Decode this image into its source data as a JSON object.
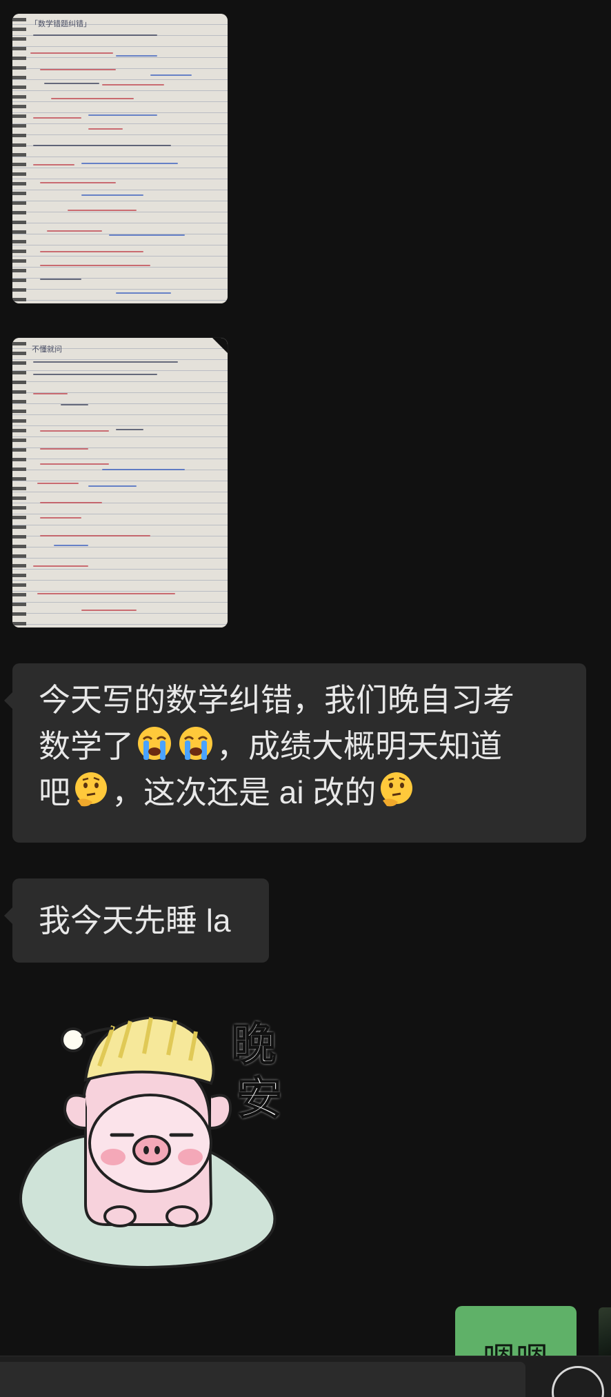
{
  "messages": [
    {
      "type": "image",
      "sender": "contact",
      "content": "handwritten-math-notes-page-1",
      "headline_scribble": "「数学错题纠错」"
    },
    {
      "type": "image",
      "sender": "contact",
      "content": "handwritten-math-notes-page-2",
      "headline_scribble": "不懂就问"
    },
    {
      "type": "text",
      "sender": "contact",
      "lines": [
        "今天写的数学纠错，我们晚自习考",
        "数学了",
        "，成绩大概明天知道",
        "吧",
        "，这次还是 ai 改的"
      ],
      "emojis": [
        "crying-face",
        "crying-face",
        "thinking-face",
        "thinking-face"
      ]
    },
    {
      "type": "text",
      "sender": "contact",
      "text": "我今天先睡 la"
    },
    {
      "type": "sticker",
      "sender": "contact",
      "sticker_text": [
        "晚",
        "安"
      ],
      "sticker_name": "sleepy-pig-goodnight"
    },
    {
      "type": "text",
      "sender": "me",
      "text": "嗯嗯"
    }
  ],
  "input": {
    "placeholder": ""
  },
  "colors": {
    "background": "#111111",
    "incoming_bubble": "#2c2c2c",
    "outgoing_bubble": "#5fb168",
    "text_light": "#e8e8e8"
  },
  "icons": {
    "voice_toggle": "circle-icon"
  }
}
